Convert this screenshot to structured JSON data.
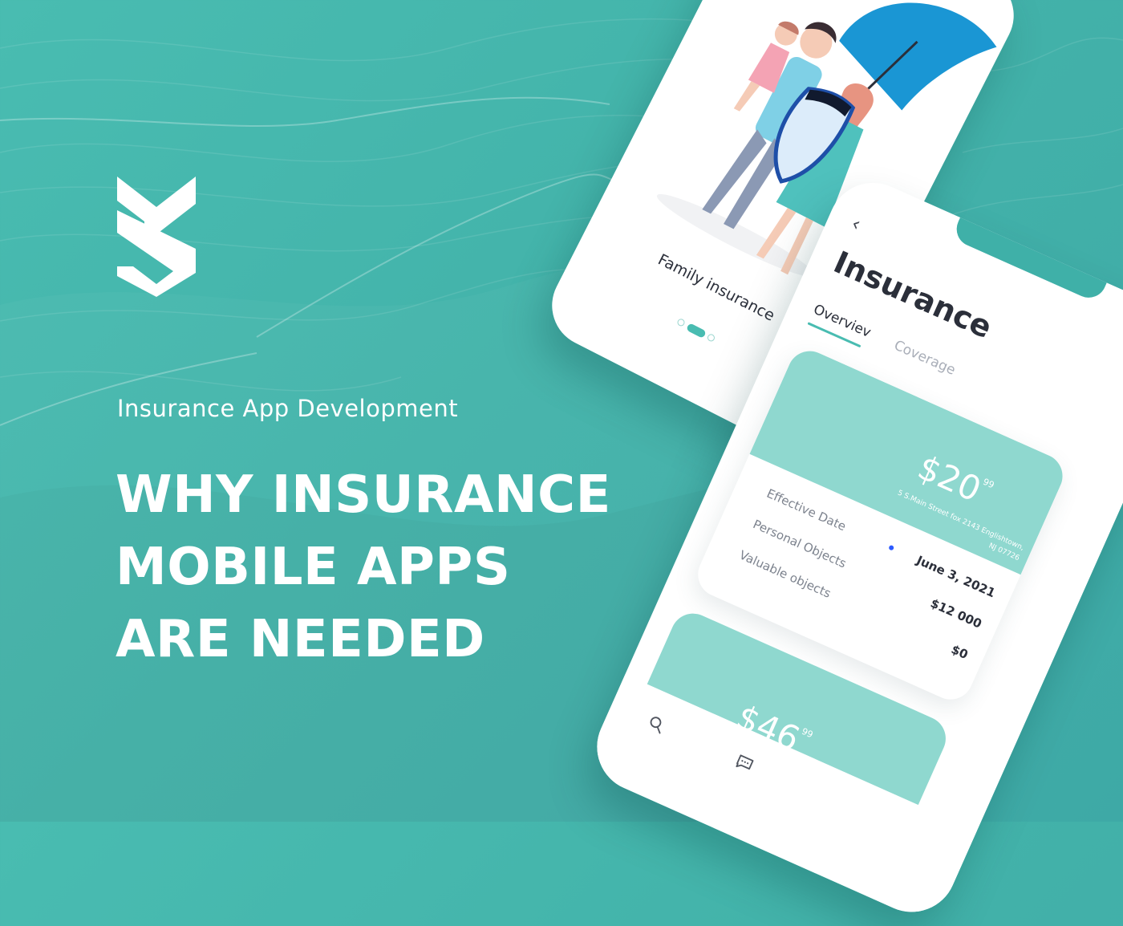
{
  "brand": {
    "logo_icon": "sm-shield-logo-icon"
  },
  "hero": {
    "subtitle": "Insurance App Development",
    "headline_lines": [
      "WHY INSURANCE",
      "MOBILE APPS",
      "ARE NEEDED"
    ]
  },
  "phone1": {
    "illustration_icon": "family-umbrella-shield-icon",
    "label": "Family insurance",
    "pager": {
      "pages": 3,
      "active": 2
    }
  },
  "phone2": {
    "back_icon": "chevron-left-icon",
    "title": "Insurance",
    "tabs": [
      {
        "label": "Overviev",
        "active": true
      },
      {
        "label": "Coverage",
        "active": false
      }
    ],
    "card1": {
      "price": "$20",
      "cents": "99",
      "address_line1": "5 S.Main Street fox 2143 Englishtown,",
      "address_line2": "NJ 07726",
      "rows": [
        {
          "label": "Effective Date",
          "value": "June 3,  2021"
        },
        {
          "label": "Personal Objects",
          "value": "$12 000"
        },
        {
          "label": "Valuable objects",
          "value": "$0"
        }
      ]
    },
    "card2": {
      "price": "$46",
      "cents": "99"
    },
    "nav": [
      {
        "icon": "search-icon"
      },
      {
        "icon": "chat-icon"
      }
    ]
  },
  "colors": {
    "background": "#45b5ac",
    "accent": "#49bcb1",
    "card_teal": "#8fd8cf",
    "text_dark": "#2b2f3a",
    "text_muted": "#7d838e"
  }
}
